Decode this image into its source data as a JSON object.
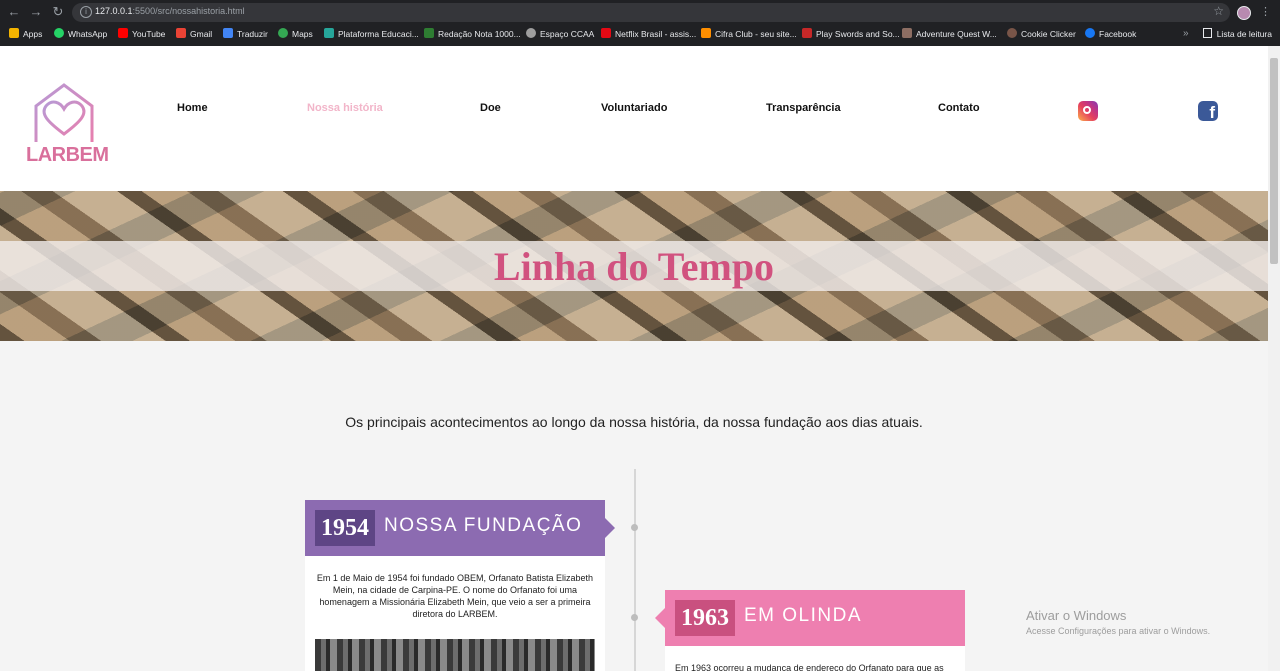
{
  "browser": {
    "url_host": "127.0.0.1",
    "url_port_path": ":5500/src/nossahistoria.html",
    "bookmarks": [
      {
        "label": "Apps",
        "color": "#f4b400"
      },
      {
        "label": "WhatsApp",
        "color": "#25d366"
      },
      {
        "label": "YouTube",
        "color": "#ff0000"
      },
      {
        "label": "Gmail",
        "color": "#ea4335"
      },
      {
        "label": "Traduzir",
        "color": "#4285f4"
      },
      {
        "label": "Maps",
        "color": "#34a853"
      },
      {
        "label": "Plataforma Educaci...",
        "color": "#26a69a"
      },
      {
        "label": "Redação Nota 1000...",
        "color": "#2e7d32"
      },
      {
        "label": "Espaço CCAA",
        "color": "#9e9e9e"
      },
      {
        "label": "Netflix Brasil - assis...",
        "color": "#e50914"
      },
      {
        "label": "Cifra Club - seu site...",
        "color": "#ff8f00"
      },
      {
        "label": "Play Swords and So...",
        "color": "#c62828"
      },
      {
        "label": "Adventure Quest W...",
        "color": "#8d6e63"
      },
      {
        "label": "Cookie Clicker",
        "color": "#795548"
      },
      {
        "label": "Facebook",
        "color": "#1877f2"
      }
    ],
    "reading_list": "Lista de leitura",
    "more": "»"
  },
  "site": {
    "logo_text": "LARBEM",
    "brand_pink": "#d9709c",
    "nav": [
      {
        "label": "Home",
        "active": false
      },
      {
        "label": "Nossa história",
        "active": true
      },
      {
        "label": "Doe",
        "active": false
      },
      {
        "label": "Voluntariado",
        "active": false
      },
      {
        "label": "Transparência",
        "active": false
      },
      {
        "label": "Contato",
        "active": false
      }
    ],
    "social": [
      "instagram-icon",
      "facebook-icon"
    ]
  },
  "banner": {
    "title": "Linha do Tempo"
  },
  "intro": "Os principais acontecimentos ao longo da nossa história, da nossa fundação aos dias atuais.",
  "timeline": [
    {
      "year": "1954",
      "title": "NOSSA FUNDAÇÃO",
      "color": "#8c6bb1",
      "year_bg": "#5e4585",
      "text": "Em 1 de Maio de 1954 foi fundado OBEM, Orfanato Batista Elizabeth Mein, na cidade de Carpina-PE. O nome do Orfanato foi uma homenagem a Missionária Elizabeth Mein, que veio a ser a primeira diretora do LARBEM."
    },
    {
      "year": "1963",
      "title": "EM OLINDA",
      "color": "#ee7fb0",
      "year_bg": "#c9507f",
      "text": "Em 1963 ocorreu a mudança de endereço do Orfanato para que as"
    }
  ],
  "watermark": {
    "line1": "Ativar o Windows",
    "line2": "Acesse Configurações para ativar o Windows."
  }
}
